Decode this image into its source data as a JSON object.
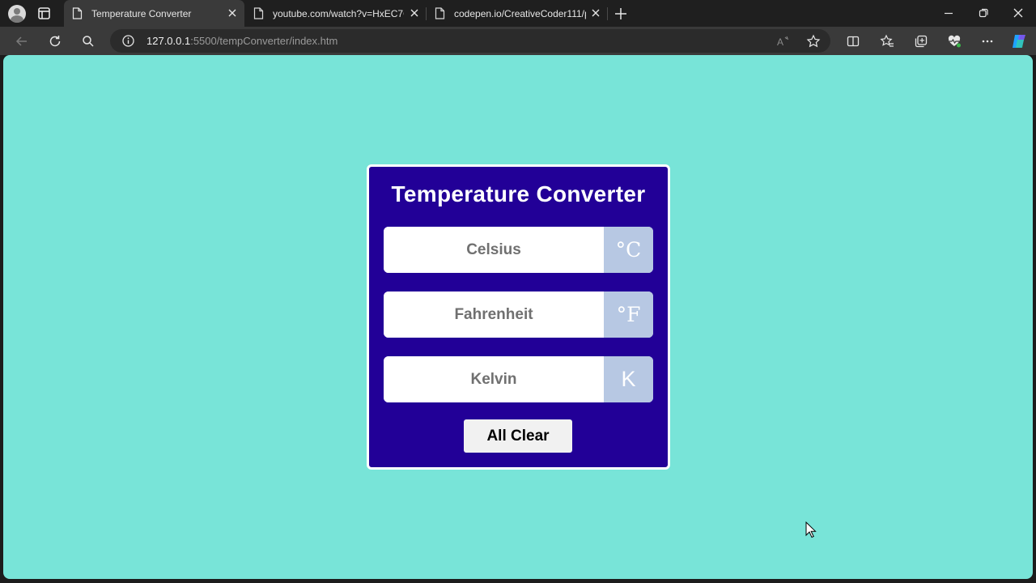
{
  "browser": {
    "tabs": [
      {
        "title": "Temperature Converter",
        "active": true
      },
      {
        "title": "youtube.com/watch?v=HxEC7Q",
        "active": false
      },
      {
        "title": "codepen.io/CreativeCoder111/p",
        "active": false
      }
    ],
    "address": {
      "host": "127.0.0.1",
      "path": ":5500/tempConverter/index.htm"
    }
  },
  "page": {
    "background": "#78e4d8",
    "card_color": "#220097",
    "title": "Temperature Converter",
    "fields": [
      {
        "placeholder": "Celsius",
        "unit": "°C"
      },
      {
        "placeholder": "Fahrenheit",
        "unit": "°F"
      },
      {
        "placeholder": "Kelvin",
        "unit": "K"
      }
    ],
    "clear_label": "All Clear"
  },
  "icons": [
    "profile-icon",
    "tab-actions-icon",
    "page-icon",
    "close-icon",
    "new-tab-icon",
    "minimize-icon",
    "restore-icon",
    "back-icon",
    "refresh-icon",
    "search-icon",
    "info-icon",
    "read-aloud-icon",
    "favorite-star-icon",
    "split-screen-icon",
    "favorites-icon",
    "collections-icon",
    "health-icon",
    "more-icon",
    "copilot-icon",
    "cursor-icon"
  ]
}
